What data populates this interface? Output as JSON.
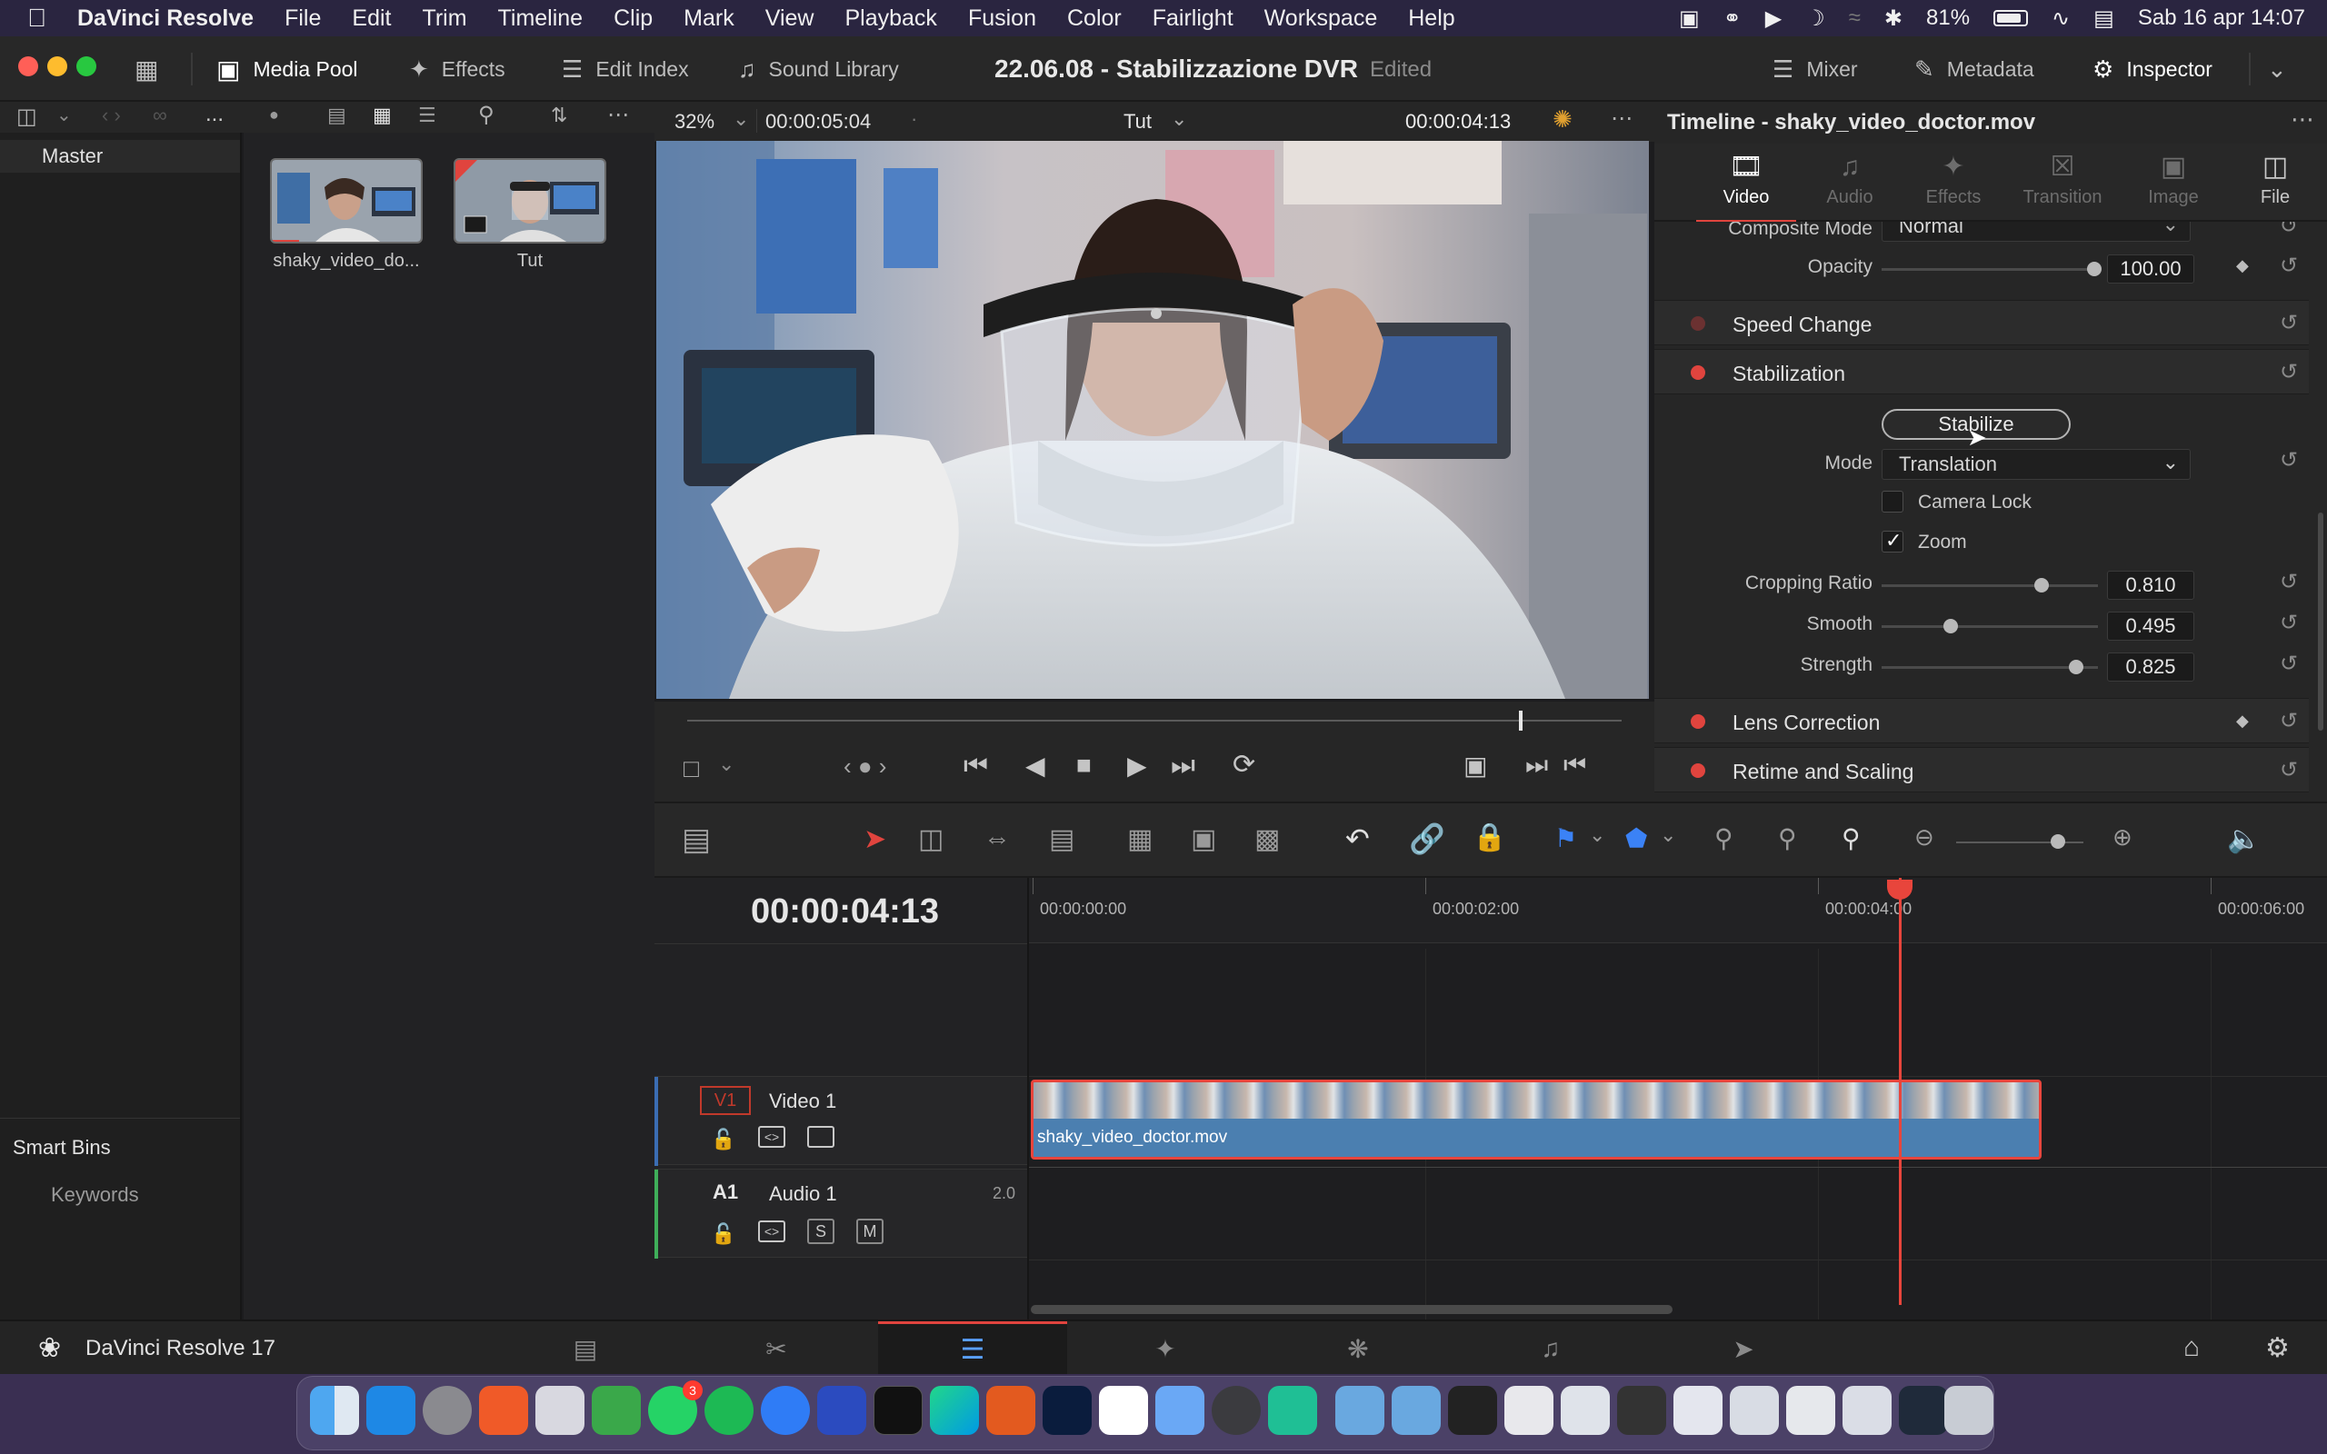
{
  "menubar": {
    "app_name": "DaVinci Resolve",
    "items": [
      "File",
      "Edit",
      "Trim",
      "Timeline",
      "Clip",
      "Mark",
      "View",
      "Playback",
      "Fusion",
      "Color",
      "Fairlight",
      "Workspace",
      "Help"
    ],
    "battery": "81%",
    "clock": "Sab 16 apr  14:07"
  },
  "toolbar": {
    "media_pool": "Media Pool",
    "effects": "Effects",
    "edit_index": "Edit Index",
    "sound_library": "Sound Library",
    "project_title": "22.06.08 - Stabilizzazione DVR",
    "project_status": "Edited",
    "mixer": "Mixer",
    "metadata": "Metadata",
    "inspector": "Inspector"
  },
  "media_pool": {
    "ellipsis": "...",
    "bins": {
      "master": "Master",
      "smart_bins": "Smart Bins",
      "keywords": "Keywords"
    },
    "clips": [
      {
        "label": "shaky_video_do..."
      },
      {
        "label": "Tut"
      }
    ]
  },
  "viewer": {
    "zoom": "32%",
    "source_timecode": "00:00:05:04",
    "timeline_name": "Tut",
    "record_timecode": "00:00:04:13",
    "scrub_position": 0.89
  },
  "inspector": {
    "header": "Timeline - shaky_video_doctor.mov",
    "tabs": [
      {
        "label": "Video",
        "active": true
      },
      {
        "label": "Audio",
        "active": false
      },
      {
        "label": "Effects",
        "active": false
      },
      {
        "label": "Transition",
        "active": false
      },
      {
        "label": "Image",
        "active": false
      },
      {
        "label": "File",
        "active": false
      }
    ],
    "composite_mode_label": "Composite Mode",
    "composite_mode_value": "Normal",
    "opacity_label": "Opacity",
    "opacity_value": "100.00",
    "sections": {
      "speed_change": "Speed Change",
      "stabilization": "Stabilization",
      "lens_correction": "Lens Correction",
      "retime_scaling": "Retime and Scaling"
    },
    "stabilize_button": "Stabilize",
    "mode_label": "Mode",
    "mode_value": "Translation",
    "camera_lock_label": "Camera Lock",
    "camera_lock_checked": false,
    "zoom_label": "Zoom",
    "zoom_checked": true,
    "cropping_ratio_label": "Cropping Ratio",
    "cropping_ratio_value": "0.810",
    "smooth_label": "Smooth",
    "smooth_value": "0.495",
    "strength_label": "Strength",
    "strength_value": "0.825"
  },
  "timeline": {
    "timecode": "00:00:04:13",
    "ruler": [
      "00:00:00:00",
      "00:00:02:00",
      "00:00:04:00",
      "00:00:06:00"
    ],
    "tracks": {
      "v1_tag": "V1",
      "v1_name": "Video 1",
      "a1_tag": "A1",
      "a1_name": "Audio 1",
      "a1_channels": "2.0",
      "solo": "S",
      "mute": "M"
    },
    "clip_name": "shaky_video_doctor.mov"
  },
  "pagebar": {
    "app_label": "DaVinci Resolve 17"
  },
  "dock": {
    "badge": "3"
  },
  "colors": {
    "accent_red": "#e0443e",
    "clip_blue": "#4b7fb0",
    "playhead": "#e8453c"
  }
}
